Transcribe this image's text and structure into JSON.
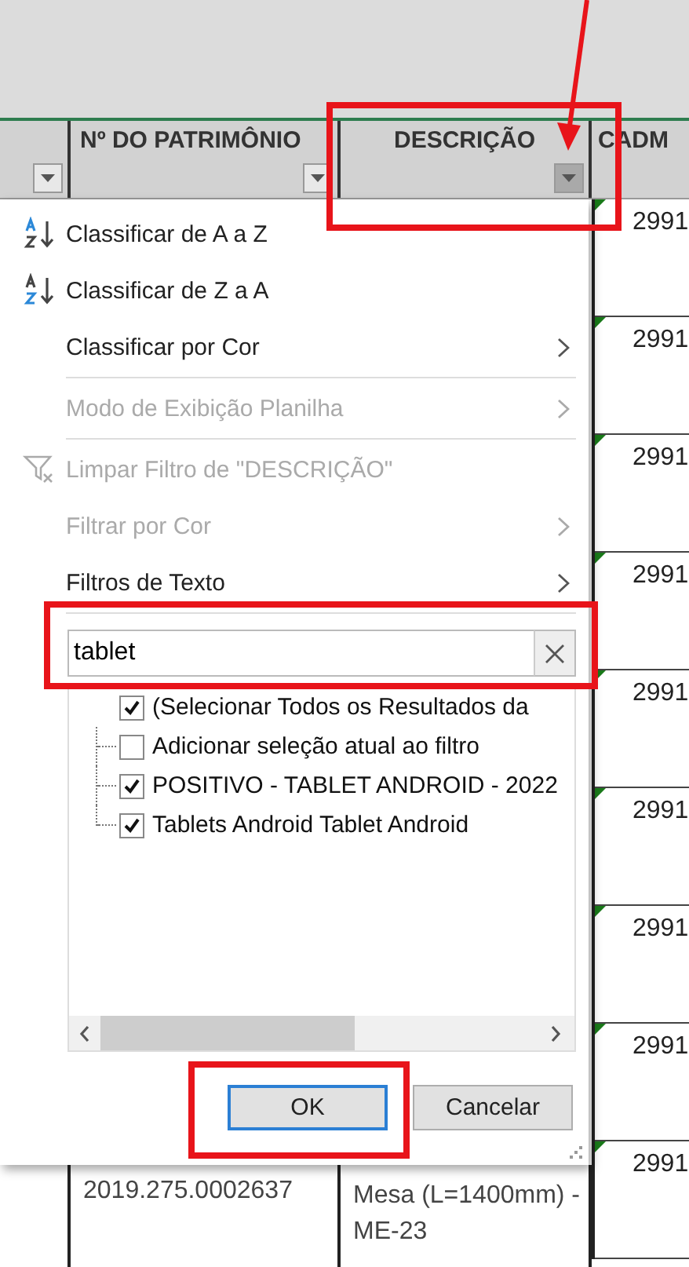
{
  "columns": [
    {
      "filter_button": true
    },
    {
      "label": "Nº DO PATRIMÔNIO",
      "filter_button": true
    },
    {
      "label": "DESCRIÇÃO",
      "filter_button": true
    },
    {
      "label": "CADM",
      "filter_button": false
    }
  ],
  "side_cells": [
    "2991",
    "2991",
    "2991",
    "2991",
    "2991",
    "2991",
    "2991",
    "2991",
    "2991"
  ],
  "menu": [
    {
      "kind": "sort_asc",
      "label": "Classificar de A a Z",
      "disabled": false,
      "submenu": false
    },
    {
      "kind": "sort_desc",
      "label": "Classificar de Z a A",
      "disabled": false,
      "submenu": false
    },
    {
      "kind": "item",
      "label": "Classificar por Cor",
      "disabled": false,
      "submenu": true
    },
    {
      "kind": "item",
      "label": "Modo de Exibição Planilha",
      "disabled": true,
      "submenu": true
    },
    {
      "kind": "clear_filter",
      "label": "Limpar Filtro de \"DESCRIÇÃO\"",
      "disabled": true,
      "submenu": false
    },
    {
      "kind": "item",
      "label": "Filtrar por Cor",
      "disabled": true,
      "submenu": true
    },
    {
      "kind": "item",
      "label": "Filtros de Texto",
      "disabled": false,
      "submenu": true
    }
  ],
  "search": {
    "value": "tablet"
  },
  "checklist": [
    {
      "label": "(Selecionar Todos os Resultados da",
      "checked": true,
      "children": [
        {
          "label": "Adicionar seleção atual ao filtro",
          "checked": false
        },
        {
          "label": "POSITIVO - TABLET ANDROID - 2022",
          "checked": true
        },
        {
          "label": "Tablets Android Tablet Android",
          "checked": true
        }
      ]
    }
  ],
  "buttons": [
    {
      "label": "OK",
      "focused": true
    },
    {
      "label": "Cancelar",
      "focused": false
    }
  ],
  "bottom_row": {
    "patrimonio": "2019.275.0002637",
    "descricao": "Mesa (L=1400mm) - ME-23"
  },
  "annotations": [
    {
      "kind": "arrow"
    },
    {
      "kind": "box"
    },
    {
      "kind": "box"
    },
    {
      "kind": "box"
    }
  ]
}
